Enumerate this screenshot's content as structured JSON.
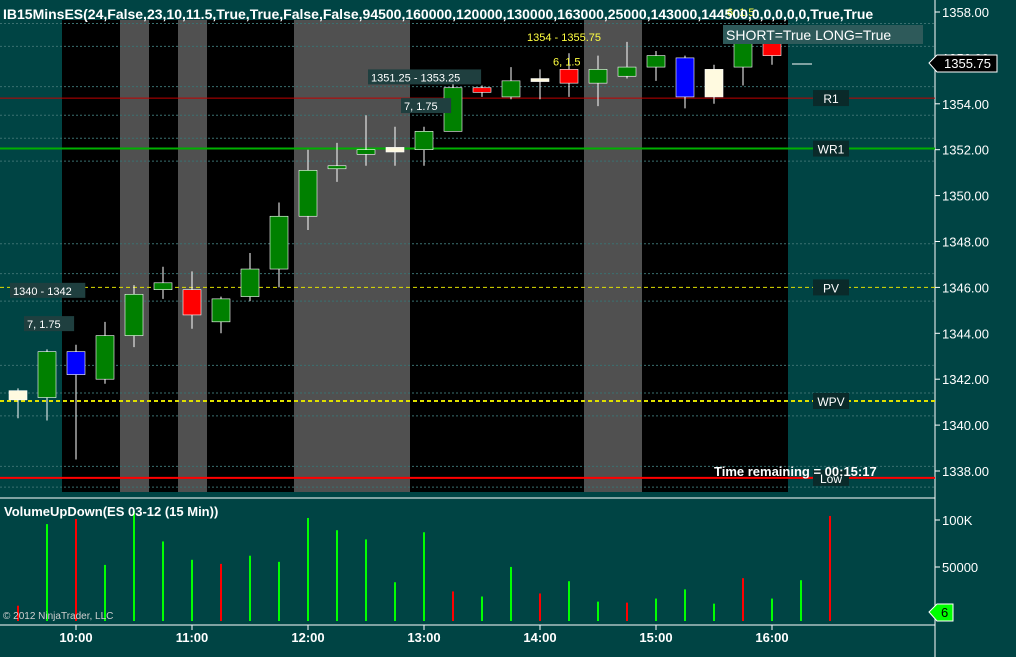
{
  "window": {
    "title": "IB15MinsES(24,False,23,10,11.5,True,True,False,False,94500,160000,120000,130000,163000,25000,143000,144500,0,0,0,0,0,True,True",
    "copyright": "© 2012 NinjaTrader, LLC"
  },
  "status": {
    "short_long": "SHORT=True LONG=True",
    "time_remaining": "Time remaining = 00:15:17",
    "last_price": "1355.75",
    "volume_badge": "6"
  },
  "colors": {
    "background": "#004444",
    "session": "#000000",
    "shade": "#505050",
    "up": "#008000",
    "down": "#ff0000",
    "blue": "#0000ff",
    "cream": "#fffae0",
    "lime": "#00ff00"
  },
  "chart_data": [
    {
      "type": "candlestick",
      "y_axis": {
        "min": 1337,
        "max": 1358.5,
        "ticks": [
          "1358.00",
          "1356.00",
          "1354.00",
          "1352.00",
          "1350.00",
          "1348.00",
          "1346.00",
          "1344.00",
          "1342.00",
          "1340.00",
          "1338.00"
        ]
      },
      "x_axis": {
        "ticks": [
          "10:00",
          "11:00",
          "12:00",
          "13:00",
          "14:00",
          "15:00",
          "16:00"
        ]
      },
      "candles": [
        {
          "t": "9:45",
          "o": 1341.1,
          "h": 1341.6,
          "l": 1340.3,
          "c": 1341.5,
          "color": "cream"
        },
        {
          "t": "9:52",
          "o": 1341.2,
          "h": 1343.3,
          "l": 1340.2,
          "c": 1343.2,
          "color": "up"
        },
        {
          "t": "10:00",
          "o": 1343.2,
          "h": 1343.5,
          "l": 1338.5,
          "c": 1342.2,
          "color": "blue"
        },
        {
          "t": "10:15",
          "o": 1342.0,
          "h": 1344.5,
          "l": 1341.8,
          "c": 1343.9,
          "color": "up"
        },
        {
          "t": "10:30",
          "o": 1343.9,
          "h": 1346.1,
          "l": 1343.4,
          "c": 1345.7,
          "color": "up"
        },
        {
          "t": "10:45",
          "o": 1345.9,
          "h": 1346.9,
          "l": 1345.5,
          "c": 1346.2,
          "color": "up"
        },
        {
          "t": "11:00",
          "o": 1345.9,
          "h": 1346.7,
          "l": 1344.2,
          "c": 1344.8,
          "color": "down"
        },
        {
          "t": "11:15",
          "o": 1344.5,
          "h": 1345.6,
          "l": 1344.0,
          "c": 1345.5,
          "color": "up"
        },
        {
          "t": "11:30",
          "o": 1345.6,
          "h": 1347.5,
          "l": 1345.4,
          "c": 1346.8,
          "color": "up"
        },
        {
          "t": "11:45",
          "o": 1346.8,
          "h": 1349.7,
          "l": 1346.0,
          "c": 1349.1,
          "color": "up"
        },
        {
          "t": "12:00",
          "o": 1349.1,
          "h": 1352.0,
          "l": 1348.5,
          "c": 1351.1,
          "color": "up"
        },
        {
          "t": "12:15",
          "o": 1351.3,
          "h": 1352.3,
          "l": 1350.6,
          "c": 1351.3,
          "color": "up"
        },
        {
          "t": "12:30",
          "o": 1351.8,
          "h": 1353.5,
          "l": 1351.3,
          "c": 1352.0,
          "color": "up"
        },
        {
          "t": "12:45",
          "o": 1351.9,
          "h": 1353.0,
          "l": 1351.3,
          "c": 1352.1,
          "color": "cream"
        },
        {
          "t": "13:00",
          "o": 1352.0,
          "h": 1353.0,
          "l": 1351.3,
          "c": 1352.8,
          "color": "up"
        },
        {
          "t": "13:15",
          "o": 1352.8,
          "h": 1355.0,
          "l": 1352.8,
          "c": 1354.7,
          "color": "up"
        },
        {
          "t": "13:30",
          "o": 1354.7,
          "h": 1354.8,
          "l": 1354.3,
          "c": 1354.5,
          "color": "down"
        },
        {
          "t": "13:45",
          "o": 1354.3,
          "h": 1355.6,
          "l": 1354.2,
          "c": 1355.0,
          "color": "up"
        },
        {
          "t": "14:00",
          "o": 1355.0,
          "h": 1355.5,
          "l": 1354.2,
          "c": 1355.1,
          "color": "cream"
        },
        {
          "t": "14:15",
          "o": 1355.5,
          "h": 1356.2,
          "l": 1354.3,
          "c": 1354.9,
          "color": "down"
        },
        {
          "t": "14:30",
          "o": 1354.9,
          "h": 1356.1,
          "l": 1353.9,
          "c": 1355.5,
          "color": "up"
        },
        {
          "t": "14:45",
          "o": 1355.2,
          "h": 1356.7,
          "l": 1355.1,
          "c": 1355.6,
          "color": "up"
        },
        {
          "t": "15:00",
          "o": 1355.6,
          "h": 1356.3,
          "l": 1355.0,
          "c": 1356.1,
          "color": "up"
        },
        {
          "t": "15:15",
          "o": 1356.0,
          "h": 1356.1,
          "l": 1353.8,
          "c": 1354.3,
          "color": "blue"
        },
        {
          "t": "15:30",
          "o": 1355.5,
          "h": 1355.7,
          "l": 1354.0,
          "c": 1354.3,
          "color": "cream"
        },
        {
          "t": "15:45",
          "o": 1355.6,
          "h": 1356.9,
          "l": 1354.8,
          "c": 1356.8,
          "color": "up"
        },
        {
          "t": "16:00",
          "o": 1356.8,
          "h": 1357.0,
          "l": 1355.7,
          "c": 1356.1,
          "color": "down"
        }
      ],
      "levels": [
        {
          "name": "R1",
          "price": 1354.25,
          "label": "R1"
        },
        {
          "name": "WR1",
          "price": 1352.05,
          "label": "WR1"
        },
        {
          "name": "PV",
          "price": 1346.0,
          "label": "PV"
        },
        {
          "name": "WPV",
          "price": 1341.05,
          "label": "WPV"
        },
        {
          "name": "Low",
          "price": 1337.7,
          "label": "Low"
        }
      ],
      "annotations": [
        {
          "text": "1354 - 1355.75",
          "at": "12:45-14:00",
          "price": 1356.9
        },
        {
          "text": "6, 1.5",
          "at": "14:00",
          "price": 1355.85
        },
        {
          "text": "6, 1.5",
          "at": "16:00",
          "price": 1358.0
        },
        {
          "text": "1351.25 - 1353.25",
          "at": "12:15-13:30",
          "price": 1355.15
        },
        {
          "text": "7, 1.75",
          "at": "13:00",
          "price": 1353.9
        },
        {
          "text": "1340 - 1342",
          "at": "9:45-10:15",
          "price": 1345.85
        },
        {
          "text": "7, 1.75",
          "at": "9:45",
          "price": 1344.4
        }
      ]
    },
    {
      "type": "bar",
      "title": "VolumeUpDown(ES 03-12 (15 Min))",
      "y_axis": {
        "min": 0,
        "max": 112000,
        "ticks": [
          "100K",
          "50000"
        ]
      },
      "values": [
        {
          "v": 15000,
          "dir": "down"
        },
        {
          "v": 95000,
          "dir": "up"
        },
        {
          "v": 100000,
          "dir": "down"
        },
        {
          "v": 55000,
          "dir": "up"
        },
        {
          "v": 108000,
          "dir": "up"
        },
        {
          "v": 78000,
          "dir": "up"
        },
        {
          "v": 60000,
          "dir": "up"
        },
        {
          "v": 56000,
          "dir": "down"
        },
        {
          "v": 64000,
          "dir": "up"
        },
        {
          "v": 58000,
          "dir": "up"
        },
        {
          "v": 101000,
          "dir": "up"
        },
        {
          "v": 89000,
          "dir": "up"
        },
        {
          "v": 80000,
          "dir": "up"
        },
        {
          "v": 38000,
          "dir": "up"
        },
        {
          "v": 87000,
          "dir": "up"
        },
        {
          "v": 29000,
          "dir": "down"
        },
        {
          "v": 24000,
          "dir": "up"
        },
        {
          "v": 53000,
          "dir": "up"
        },
        {
          "v": 27000,
          "dir": "down"
        },
        {
          "v": 39000,
          "dir": "up"
        },
        {
          "v": 19000,
          "dir": "up"
        },
        {
          "v": 18000,
          "dir": "down"
        },
        {
          "v": 22000,
          "dir": "up"
        },
        {
          "v": 31000,
          "dir": "up"
        },
        {
          "v": 17000,
          "dir": "up"
        },
        {
          "v": 42000,
          "dir": "down"
        },
        {
          "v": 22000,
          "dir": "up"
        },
        {
          "v": 40000,
          "dir": "up"
        },
        {
          "v": 103000,
          "dir": "down"
        }
      ]
    }
  ]
}
